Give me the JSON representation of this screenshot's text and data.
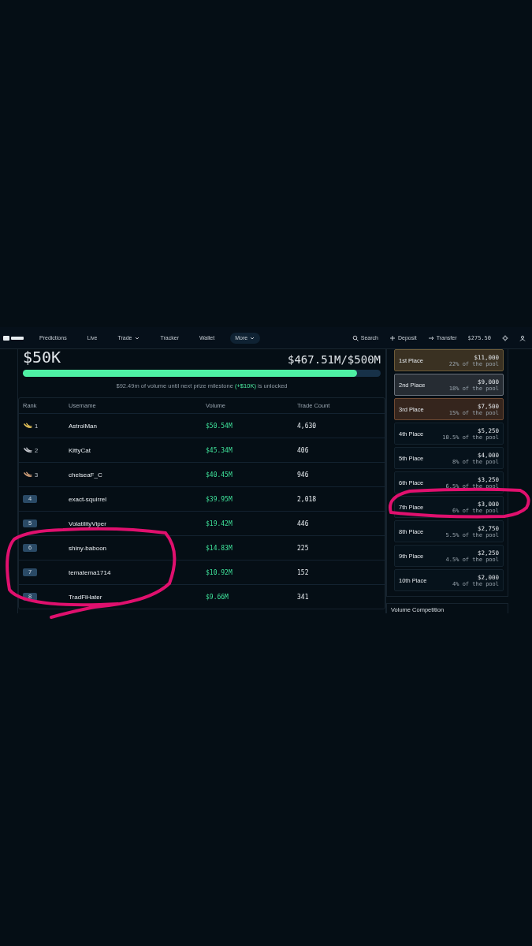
{
  "nav": {
    "items": [
      {
        "label": "Predictions",
        "selected": false,
        "caret": false
      },
      {
        "label": "Live",
        "selected": false,
        "caret": false
      },
      {
        "label": "Trade",
        "selected": false,
        "caret": true
      },
      {
        "label": "Tracker",
        "selected": false,
        "caret": false
      },
      {
        "label": "Wallet",
        "selected": false,
        "caret": false
      },
      {
        "label": "More",
        "selected": true,
        "caret": true
      }
    ],
    "search": "Search",
    "deposit": "Deposit",
    "transfer": "Transfer",
    "balance": "$275.50"
  },
  "prize": {
    "amount": "$50K",
    "progress_text": "$467.51M/$500M",
    "level": 0.935,
    "milestone_before": "$92.49m of volume until next prize milestone",
    "milestone_bonus": "(+$10K)",
    "milestone_after": "is unlocked"
  },
  "table": {
    "columns": [
      "Rank",
      "Username",
      "Volume",
      "Trade Count"
    ],
    "rows": [
      {
        "rank": "1",
        "kind": "medal",
        "color": "#e8c55a",
        "username": "AstrolMan",
        "volume": "$50.54M",
        "trades": "4,630"
      },
      {
        "rank": "2",
        "kind": "medal",
        "color": "#c9ccd2",
        "username": "KittyCat",
        "volume": "$45.34M",
        "trades": "406"
      },
      {
        "rank": "3",
        "kind": "medal",
        "color": "#d2a07a",
        "username": "chelseaF_C",
        "volume": "$40.45M",
        "trades": "946"
      },
      {
        "rank": "4",
        "kind": "badge",
        "color": "#2a4a66",
        "username": "exact-squirrel",
        "volume": "$39.95M",
        "trades": "2,018"
      },
      {
        "rank": "5",
        "kind": "badge",
        "color": "#2a4a66",
        "username": "VolatilityViper",
        "volume": "$19.42M",
        "trades": "446"
      },
      {
        "rank": "6",
        "kind": "badge",
        "color": "#2a4a66",
        "username": "shiny-baboon",
        "volume": "$14.83M",
        "trades": "225"
      },
      {
        "rank": "7",
        "kind": "badge",
        "color": "#2a4a66",
        "username": "tematema1714",
        "volume": "$10.92M",
        "trades": "152"
      },
      {
        "rank": "8",
        "kind": "badge",
        "color": "#2a4a66",
        "username": "TradFiHater",
        "volume": "$9.66M",
        "trades": "341"
      }
    ]
  },
  "places": [
    {
      "label": "1st Place",
      "prize": "$11,000",
      "share": "22% of the pool",
      "kind": "gold"
    },
    {
      "label": "2nd Place",
      "prize": "$9,000",
      "share": "18% of the pool",
      "kind": "silver"
    },
    {
      "label": "3rd Place",
      "prize": "$7,500",
      "share": "15% of the pool",
      "kind": "bronze"
    },
    {
      "label": "4th Place",
      "prize": "$5,250",
      "share": "10.5% of the pool",
      "kind": "plain"
    },
    {
      "label": "5th Place",
      "prize": "$4,000",
      "share": "8% of the pool",
      "kind": "plain"
    },
    {
      "label": "6th Place",
      "prize": "$3,250",
      "share": "6.5% of the pool",
      "kind": "plain"
    },
    {
      "label": "7th Place",
      "prize": "$3,000",
      "share": "6% of the pool",
      "kind": "plain"
    },
    {
      "label": "8th Place",
      "prize": "$2,750",
      "share": "5.5% of the pool",
      "kind": "plain"
    },
    {
      "label": "9th Place",
      "prize": "$2,250",
      "share": "4.5% of the pool",
      "kind": "plain"
    },
    {
      "label": "10th Place",
      "prize": "$2,000",
      "share": "4% of the pool",
      "kind": "plain"
    }
  ],
  "next_card": {
    "title": "Volume Competition"
  }
}
